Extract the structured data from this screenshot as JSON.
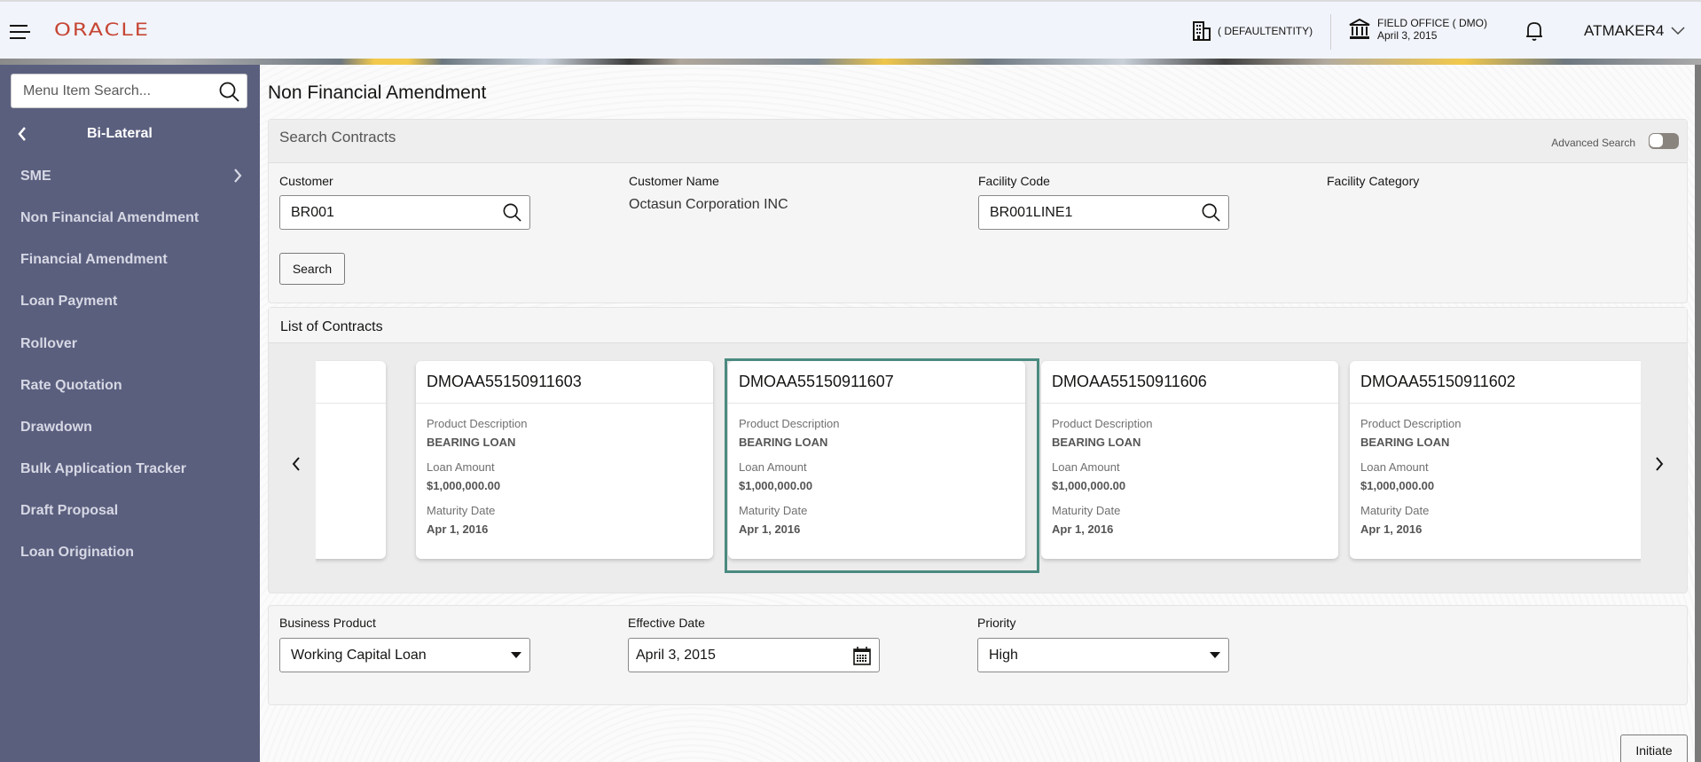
{
  "header": {
    "brand": "ORACLE",
    "entity": "( DEFAULTENTITY)",
    "office_name": "FIELD OFFICE ( DMO)",
    "office_date": "April 3, 2015",
    "user": "ATMAKER4",
    "icons": {
      "menu": "hamburger-icon",
      "entity": "building-icon",
      "office": "bank-icon",
      "notifications": "bell-icon",
      "user_menu": "chevron-down-icon"
    }
  },
  "sidebar": {
    "search_placeholder": "Menu Item Search...",
    "back_label": "Bi-Lateral",
    "items": [
      {
        "label": "SME",
        "has_submenu": true
      },
      {
        "label": "Non Financial Amendment"
      },
      {
        "label": "Financial Amendment"
      },
      {
        "label": "Loan Payment"
      },
      {
        "label": "Rollover"
      },
      {
        "label": "Rate Quotation"
      },
      {
        "label": "Drawdown"
      },
      {
        "label": "Bulk Application Tracker"
      },
      {
        "label": "Draft Proposal"
      },
      {
        "label": "Loan Origination"
      }
    ]
  },
  "page": {
    "title": "Non Financial Amendment"
  },
  "search_contracts": {
    "title": "Search Contracts",
    "advanced_search_label": "Advanced Search",
    "advanced_search_on": false,
    "customer_label": "Customer",
    "customer_value": "BR001",
    "customer_name_label": "Customer Name",
    "customer_name_value": "Octasun Corporation INC",
    "facility_code_label": "Facility Code",
    "facility_code_value": "BR001LINE1",
    "facility_category_label": "Facility Category",
    "search_button": "Search"
  },
  "contracts": {
    "title": "List of Contracts",
    "selected_index": 1,
    "cards": [
      {
        "id": "DMOAA55150911603",
        "product_label": "Product Description",
        "product": "BEARING LOAN",
        "amount_label": "Loan Amount",
        "amount": "$1,000,000.00",
        "maturity_label": "Maturity Date",
        "maturity": "Apr 1, 2016"
      },
      {
        "id": "DMOAA55150911607",
        "product_label": "Product Description",
        "product": "BEARING LOAN",
        "amount_label": "Loan Amount",
        "amount": "$1,000,000.00",
        "maturity_label": "Maturity Date",
        "maturity": "Apr 1, 2016"
      },
      {
        "id": "DMOAA55150911606",
        "product_label": "Product Description",
        "product": "BEARING LOAN",
        "amount_label": "Loan Amount",
        "amount": "$1,000,000.00",
        "maturity_label": "Maturity Date",
        "maturity": "Apr 1, 2016"
      },
      {
        "id": "DMOAA55150911602",
        "product_label": "Product Description",
        "product": "BEARING LOAN",
        "amount_label": "Loan Amount",
        "amount": "$1,000,000.00",
        "maturity_label": "Maturity Date",
        "maturity": "Apr 1, 2016"
      }
    ]
  },
  "details": {
    "business_product_label": "Business Product",
    "business_product_value": "Working Capital Loan",
    "effective_date_label": "Effective Date",
    "effective_date_value": "April 3, 2015",
    "priority_label": "Priority",
    "priority_value": "High"
  },
  "actions": {
    "initiate": "Initiate"
  },
  "colors": {
    "brand": "#c74634",
    "sidebar": "#5b5f7e",
    "selected_border": "#4a8a80"
  }
}
